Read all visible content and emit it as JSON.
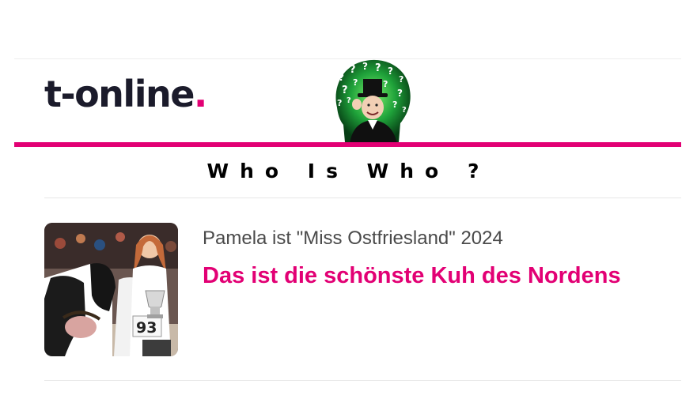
{
  "header": {
    "logo_text": "t-online",
    "logo_dot": ".",
    "mascot_icon": "question-marks-man-with-top-hat-icon"
  },
  "section": {
    "title": "Who Is Who ?"
  },
  "teaser": {
    "kicker": "Pamela ist \"Miss Ostfriesland\" 2024",
    "headline": "Das ist die schönste Kuh des Nordens",
    "image_alt": "cow-and-woman-with-trophy-photo"
  },
  "colors": {
    "brand_magenta": "#e20074",
    "logo_dark": "#1b1b2b",
    "kicker_gray": "#4a4a4a",
    "divider": "#e6e6e6"
  }
}
